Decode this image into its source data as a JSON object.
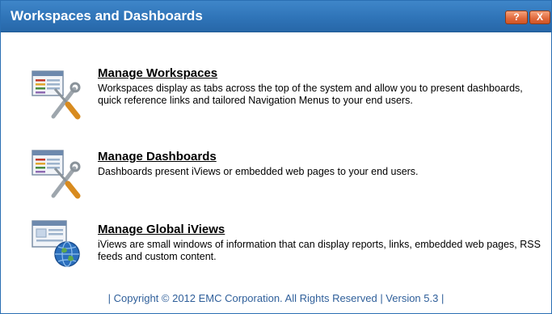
{
  "dialog": {
    "title": "Workspaces and Dashboards",
    "help_label": "?",
    "close_label": "X"
  },
  "items": [
    {
      "title": "Manage Workspaces",
      "description": "Workspaces display as tabs across the top of the system and allow you to present dashboards, quick reference links and tailored Navigation Menus to your end users.",
      "icon": "workspace-tools-icon"
    },
    {
      "title": "Manage Dashboards",
      "description": "Dashboards present iViews or embedded web pages to your end users.",
      "icon": "dashboard-tools-icon"
    },
    {
      "title": "Manage Global iViews",
      "description": "iViews are small windows of information that can display reports, links, embedded web pages, RSS feeds and custom content.",
      "icon": "global-iview-icon"
    }
  ],
  "footer": {
    "text": "| Copyright © 2012 EMC Corporation.  All Rights Reserved  |  Version 5.3  |"
  }
}
